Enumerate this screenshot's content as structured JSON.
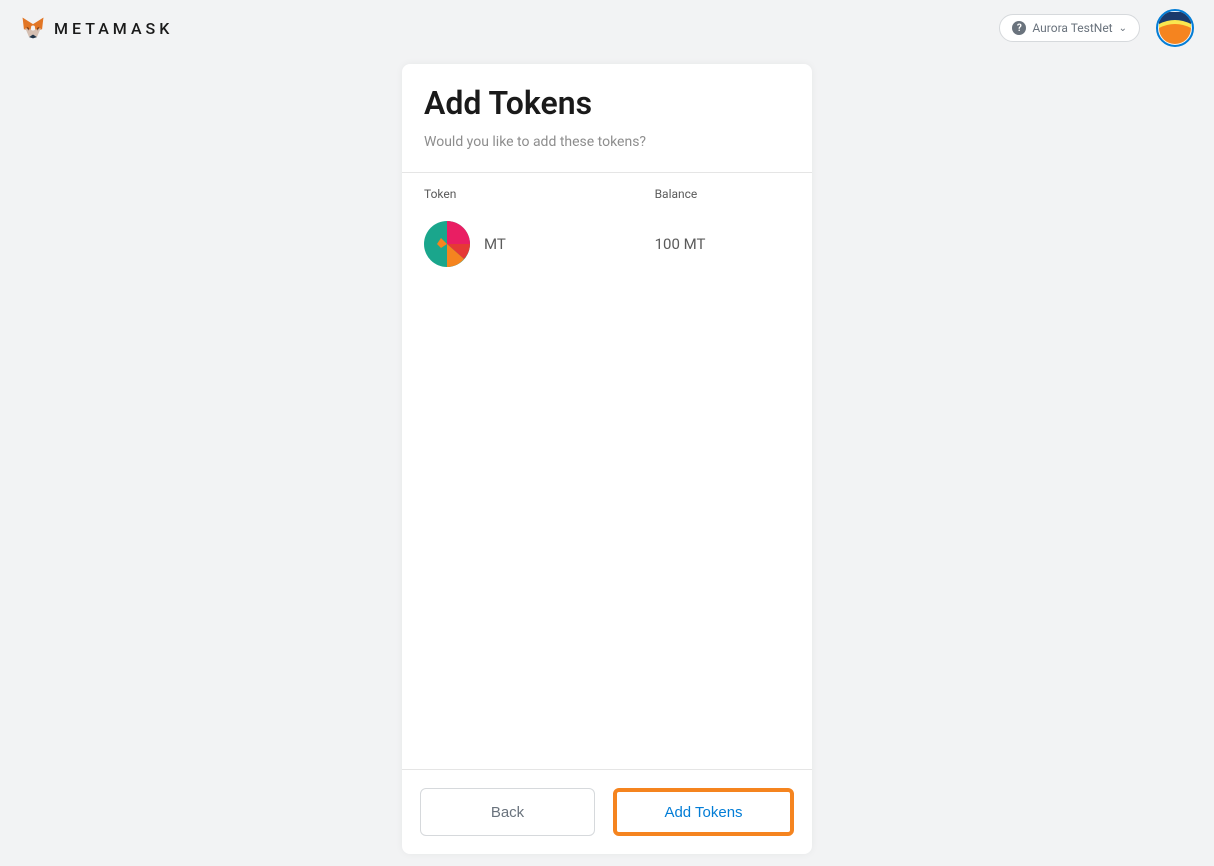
{
  "header": {
    "brand": "METAMASK",
    "network": "Aurora TestNet"
  },
  "card": {
    "title": "Add Tokens",
    "subtitle": "Would you like to add these tokens?",
    "columns": {
      "token": "Token",
      "balance": "Balance"
    },
    "tokens": [
      {
        "symbol": "MT",
        "balance": "100 MT"
      }
    ]
  },
  "footer": {
    "back": "Back",
    "add": "Add Tokens"
  }
}
